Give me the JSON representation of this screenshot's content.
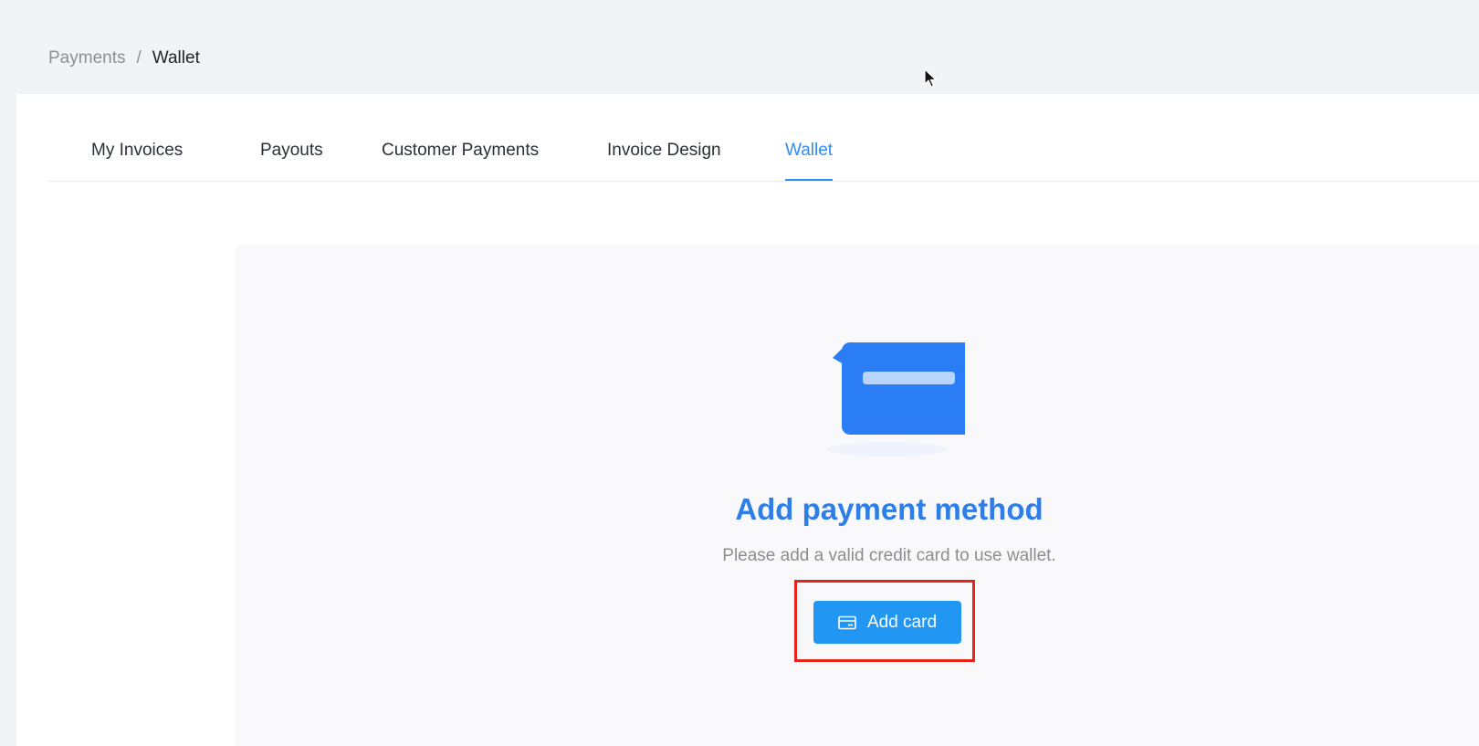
{
  "breadcrumb": {
    "parent": "Payments",
    "separator": "/",
    "current": "Wallet"
  },
  "tabs": [
    {
      "label": "My Invoices",
      "active": false
    },
    {
      "label": "Payouts",
      "active": false
    },
    {
      "label": "Customer Payments",
      "active": false
    },
    {
      "label": "Invoice Design",
      "active": false
    },
    {
      "label": "Wallet",
      "active": true
    }
  ],
  "empty_state": {
    "title": "Add payment method",
    "subtitle": "Please add a valid credit card to use wallet.",
    "illustration_icon": "credit-card-illustration",
    "button_label": "Add card",
    "button_icon": "credit-card-icon"
  },
  "colors": {
    "accent": "#2f8ef4",
    "button": "#2196f3",
    "title": "#2f7ee8",
    "highlight": "#e8231b"
  }
}
